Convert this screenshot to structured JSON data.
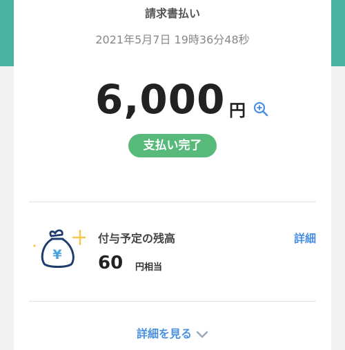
{
  "header": {
    "title": "請求書払い",
    "datetime": "2021年5月7日 19時36分48秒"
  },
  "payment": {
    "amount": "6,000",
    "currency": "円",
    "status": "支払い完了"
  },
  "points": {
    "label": "付与予定の残高",
    "value": "60",
    "unit": "円相当",
    "details_link": "詳細",
    "bag_symbol": "¥"
  },
  "footer": {
    "view_details": "詳細を見る"
  },
  "colors": {
    "accent_teal": "#4bb3a0",
    "status_green": "#57b97a",
    "link_blue": "#4a90e2",
    "bag_navy": "#1f3b6e",
    "sparkle": "#f5c84c"
  },
  "icons": [
    "zoom-in-icon",
    "money-bag-icon",
    "chevron-down-icon"
  ]
}
